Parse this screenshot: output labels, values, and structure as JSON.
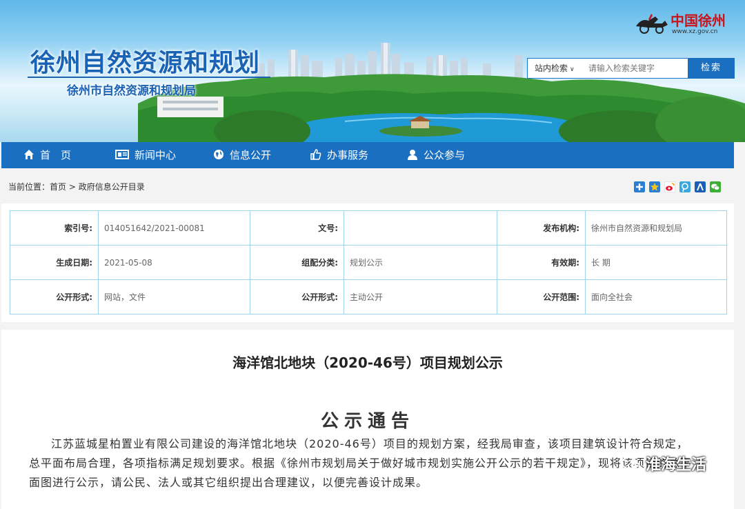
{
  "header": {
    "site_title": "徐州自然资源和规划",
    "site_subtitle": "徐州市自然资源和规划局",
    "logo_text": "中国徐州",
    "logo_url": "www.xz.gov.cn"
  },
  "search": {
    "scope_label": "站内检索",
    "placeholder": "请输入检索关键字",
    "button_label": "检索"
  },
  "nav": {
    "items": [
      {
        "label": "首　页",
        "icon": "home-icon"
      },
      {
        "label": "新闻中心",
        "icon": "news-icon"
      },
      {
        "label": "信息公开",
        "icon": "globe-icon"
      },
      {
        "label": "办事服务",
        "icon": "thumbs-up-icon"
      },
      {
        "label": "公众参与",
        "icon": "user-icon"
      }
    ]
  },
  "breadcrumb": {
    "prefix": "当前位置：",
    "home": "首页",
    "separator": ">",
    "current": "政府信息公开目录"
  },
  "share_icons": [
    "plus-icon",
    "qzone-icon",
    "weibo-icon",
    "tencent-icon",
    "renren-icon",
    "wechat-icon"
  ],
  "info": {
    "rows": [
      [
        {
          "key": "索引号:",
          "value": "014051642/2021-00081"
        },
        {
          "key": "文号:",
          "value": ""
        },
        {
          "key": "发布机构:",
          "value": "徐州市自然资源和规划局"
        }
      ],
      [
        {
          "key": "生成日期:",
          "value": "2021-05-08"
        },
        {
          "key": "组配分类:",
          "value": "规划公示"
        },
        {
          "key": "有效期:",
          "value": "长 期"
        }
      ],
      [
        {
          "key": "公开形式:",
          "value": "网站，文件"
        },
        {
          "key": "公开形式:",
          "value": "主动公开"
        },
        {
          "key": "公开范围:",
          "value": "面向全社会"
        }
      ]
    ]
  },
  "article": {
    "title": "海洋馆北地块（2020-46号）项目规划公示",
    "notice_heading": "公示通告",
    "body": "江苏蓝城星柏置业有限公司建设的海洋馆北地块（2020-46号）项目的规划方案，经我局审查，该项目建筑设计符合规定，总平面布局合理，各项指标满足规划要求。根据《徐州市规划局关于做好城市规划实施公开公示的若干规定》，现将该项目的总平面图进行公示，请公民、法人或其它组织提出合理建议，以便完善设计成果。"
  },
  "watermark": {
    "text": "淮海生活"
  },
  "colors": {
    "nav_blue": "#1b6fc0",
    "title_blue": "#1a62b3",
    "table_border": "#9ed3ec",
    "logo_red": "#c8141c"
  }
}
